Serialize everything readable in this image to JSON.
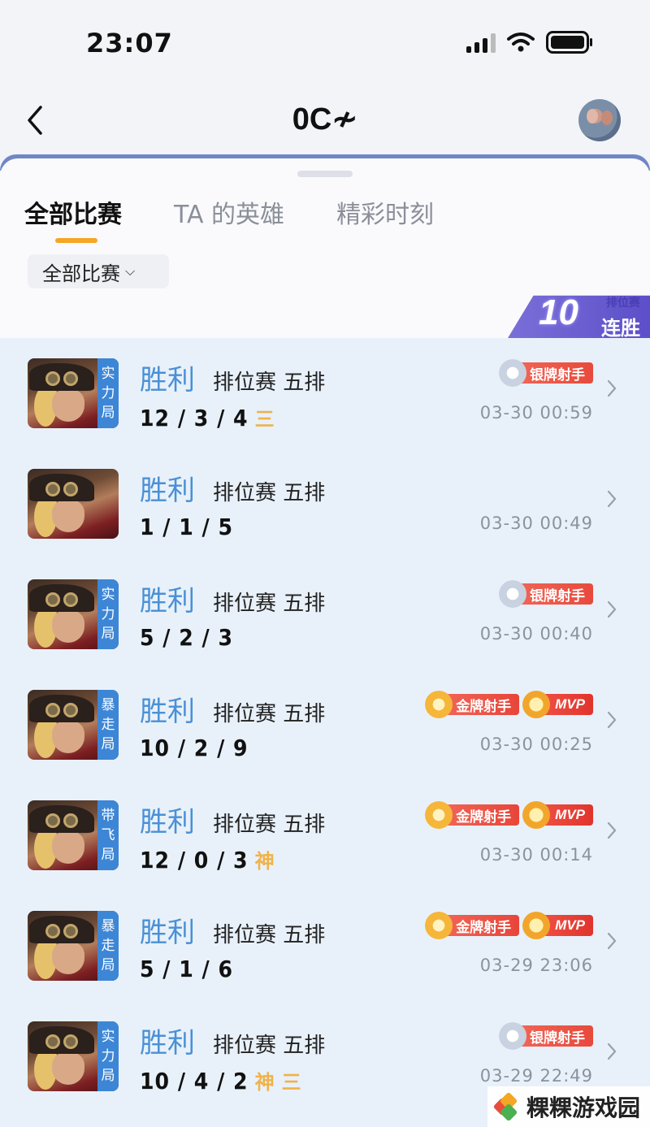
{
  "status_bar": {
    "time": "23:07"
  },
  "header": {
    "title": "0C≁"
  },
  "tabs": [
    {
      "label": "全部比赛",
      "active": true
    },
    {
      "label": "TA 的英雄",
      "active": false
    },
    {
      "label": "精彩时刻",
      "active": false
    }
  ],
  "filter": {
    "label": "全部比赛",
    "chevron": "⌵"
  },
  "streak": {
    "count": "10",
    "sub": "排位赛",
    "label": "连胜"
  },
  "matches": [
    {
      "tag": [
        "实",
        "力",
        "局"
      ],
      "result": "胜利",
      "mode": "排位赛 五排",
      "kda": "12 / 3 / 4",
      "extras": [
        "三"
      ],
      "badges": [
        {
          "type": "silver",
          "label": "银牌射手"
        }
      ],
      "date": "03-30 00:59"
    },
    {
      "tag": [],
      "result": "胜利",
      "mode": "排位赛 五排",
      "kda": "1 / 1 / 5",
      "extras": [],
      "badges": [],
      "date": "03-30 00:49"
    },
    {
      "tag": [
        "实",
        "力",
        "局"
      ],
      "result": "胜利",
      "mode": "排位赛 五排",
      "kda": "5 / 2 / 3",
      "extras": [],
      "badges": [
        {
          "type": "silver",
          "label": "银牌射手"
        }
      ],
      "date": "03-30 00:40"
    },
    {
      "tag": [
        "暴",
        "走",
        "局"
      ],
      "result": "胜利",
      "mode": "排位赛 五排",
      "kda": "10 / 2 / 9",
      "extras": [],
      "badges": [
        {
          "type": "gold",
          "label": "金牌射手"
        },
        {
          "type": "mvp",
          "label": "MVP"
        }
      ],
      "date": "03-30 00:25"
    },
    {
      "tag": [
        "带",
        "飞",
        "局"
      ],
      "result": "胜利",
      "mode": "排位赛 五排",
      "kda": "12 / 0 / 3",
      "extras": [
        "神"
      ],
      "badges": [
        {
          "type": "gold",
          "label": "金牌射手"
        },
        {
          "type": "mvp",
          "label": "MVP"
        }
      ],
      "date": "03-30 00:14"
    },
    {
      "tag": [
        "暴",
        "走",
        "局"
      ],
      "result": "胜利",
      "mode": "排位赛 五排",
      "kda": "5 / 1 / 6",
      "extras": [],
      "badges": [
        {
          "type": "gold",
          "label": "金牌射手"
        },
        {
          "type": "mvp",
          "label": "MVP"
        }
      ],
      "date": "03-29 23:06"
    },
    {
      "tag": [
        "实",
        "力",
        "局"
      ],
      "result": "胜利",
      "mode": "排位赛 五排",
      "kda": "10 / 4 / 2",
      "extras": [
        "神",
        "三"
      ],
      "badges": [
        {
          "type": "silver",
          "label": "银牌射手"
        }
      ],
      "date": "03-29 22:49"
    }
  ],
  "watermark": {
    "text": "粿粿游戏园"
  },
  "colors": {
    "accent": "#f5a623",
    "result_blue": "#4a90d6",
    "list_bg": "#e8f1fa",
    "tag_blue": "#3d86d6",
    "badge_red": "#e84a3c"
  },
  "icons": {
    "back": "chevron-left-icon",
    "row_arrow": "chevron-right-icon",
    "signal": "signal-icon",
    "wifi": "wifi-icon",
    "battery": "battery-icon"
  }
}
